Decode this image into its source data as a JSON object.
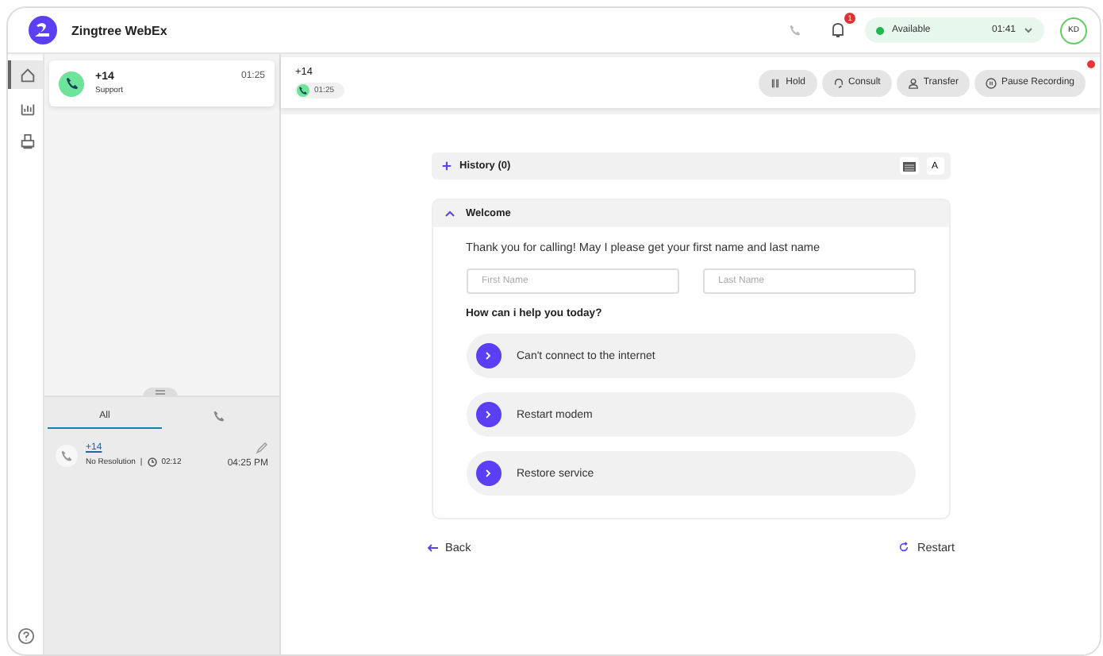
{
  "app": {
    "title": "Zingtree WebEx"
  },
  "header": {
    "notification_count": "1",
    "status": {
      "label": "Available",
      "time": "01:41"
    },
    "avatar": "KD"
  },
  "nav": [
    {
      "kind": "home",
      "selected": true
    },
    {
      "kind": "chart",
      "selected": false
    },
    {
      "kind": "printer",
      "selected": false
    }
  ],
  "active_call": {
    "number": "+14",
    "queue": "Support",
    "time": "01:25"
  },
  "tabs": [
    {
      "kind": "text",
      "label": "All",
      "selected": true
    },
    {
      "kind": "phone",
      "selected": false
    }
  ],
  "history": [
    {
      "number": "+14",
      "resolution": "No Resolution",
      "separator": "|",
      "duration": "02:12",
      "time": "04:25 PM"
    }
  ],
  "call_bar": {
    "number": "+14",
    "timer": "01:25",
    "recording_indicator": true,
    "buttons": [
      {
        "kind": "hold",
        "label": "Hold"
      },
      {
        "kind": "consult",
        "label": "Consult"
      },
      {
        "kind": "transfer",
        "label": "Transfer"
      },
      {
        "kind": "pause",
        "label": "Pause Recording"
      }
    ]
  },
  "script": {
    "history": {
      "label": "History (0)",
      "expanded": false
    },
    "font_button": "A",
    "section": {
      "title": "Welcome",
      "expanded": true
    },
    "prompt": "Thank you for calling! May I please get your first name and last name",
    "fields": [
      {
        "placeholder": "First Name"
      },
      {
        "placeholder": "Last Name"
      }
    ],
    "question": "How can i help you today?",
    "options": [
      {
        "label": "Can't connect to the internet"
      },
      {
        "label": "Restart modem"
      },
      {
        "label": "Restore service"
      }
    ]
  },
  "footer": {
    "back": "Back",
    "restart": "Restart"
  }
}
